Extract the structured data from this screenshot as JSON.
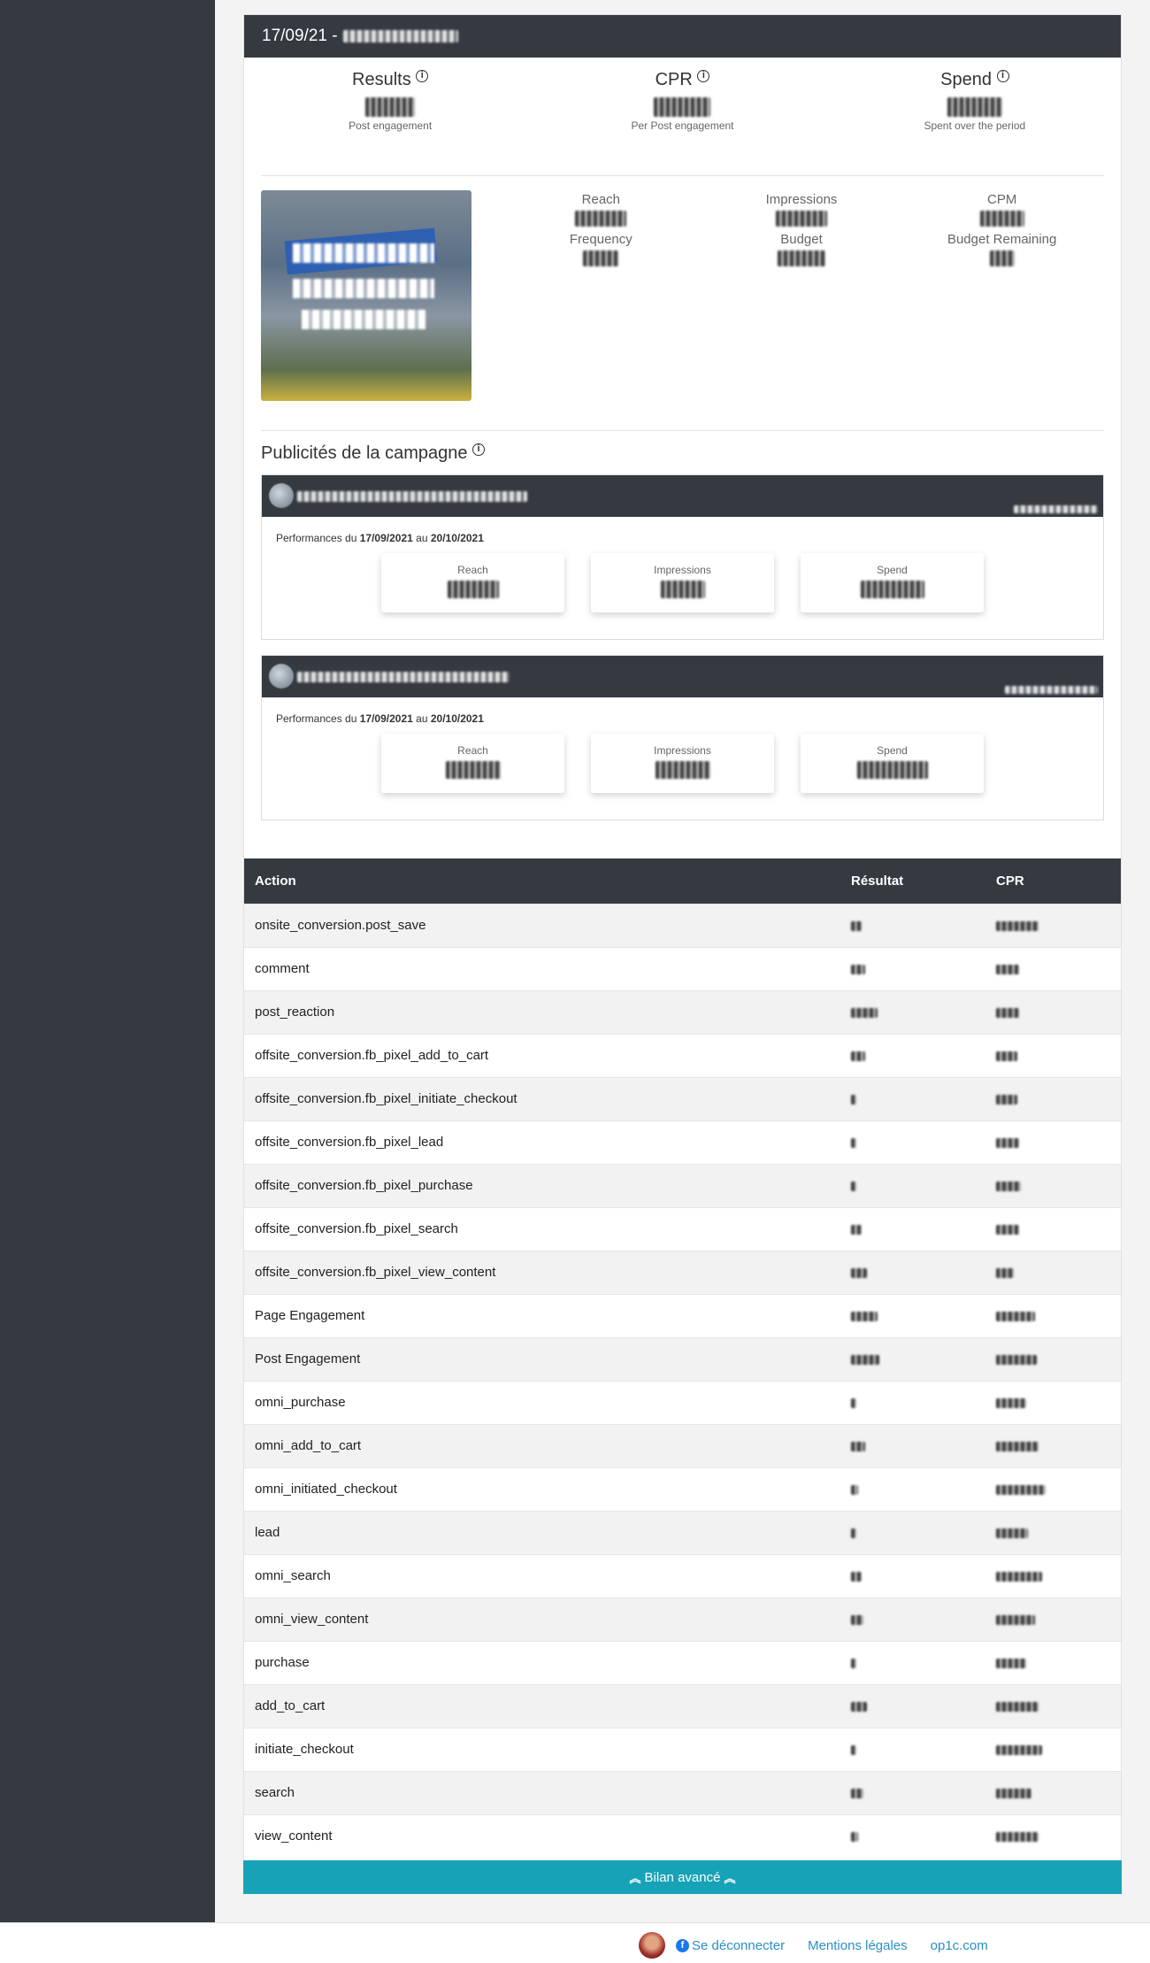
{
  "campaign": {
    "header_title": "17/09/21 -"
  },
  "kpis": [
    {
      "title": "Results",
      "subtitle": "Post engagement"
    },
    {
      "title": "CPR",
      "subtitle": "Per Post engagement"
    },
    {
      "title": "Spend",
      "subtitle": "Spent over the period"
    }
  ],
  "metrics": [
    {
      "label": "Reach"
    },
    {
      "label": "Impressions"
    },
    {
      "label": "CPM"
    },
    {
      "label": "Frequency"
    },
    {
      "label": "Budget"
    },
    {
      "label": "Budget Remaining"
    }
  ],
  "ads_section": {
    "title": "Publicités de la campagne",
    "period_prefix": "Performances du",
    "period_start": "17/09/2021",
    "period_mid": "au",
    "period_end": "20/10/2021",
    "stat_labels": [
      "Reach",
      "Impressions",
      "Spend"
    ]
  },
  "actions_table": {
    "headers": [
      "Action",
      "Résultat",
      "CPR"
    ],
    "rows": [
      "onsite_conversion.post_save",
      "comment",
      "post_reaction",
      "offsite_conversion.fb_pixel_add_to_cart",
      "offsite_conversion.fb_pixel_initiate_checkout",
      "offsite_conversion.fb_pixel_lead",
      "offsite_conversion.fb_pixel_purchase",
      "offsite_conversion.fb_pixel_search",
      "offsite_conversion.fb_pixel_view_content",
      "Page Engagement",
      "Post Engagement",
      "omni_purchase",
      "omni_add_to_cart",
      "omni_initiated_checkout",
      "lead",
      "omni_search",
      "omni_view_content",
      "purchase",
      "add_to_cart",
      "initiate_checkout",
      "search",
      "view_content"
    ]
  },
  "bilan_button": "Bilan avancé",
  "footer": {
    "logout": "Se déconnecter",
    "legal": "Mentions légales",
    "site": "op1c.com"
  },
  "colors": {
    "dark": "#343a40",
    "accent": "#17a2b8",
    "link": "#2a8fc4"
  }
}
